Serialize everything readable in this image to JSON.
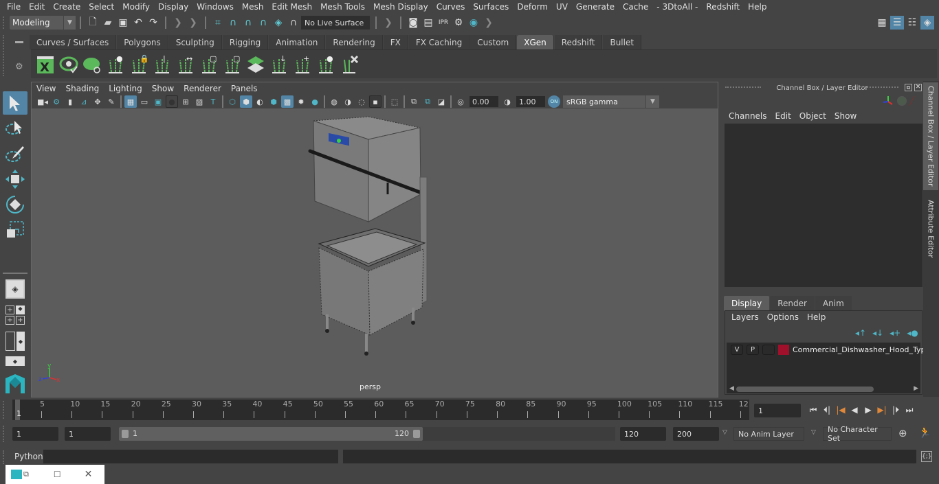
{
  "menubar": {
    "items": [
      "File",
      "Edit",
      "Create",
      "Select",
      "Modify",
      "Display",
      "Windows",
      "Mesh",
      "Edit Mesh",
      "Mesh Tools",
      "Mesh Display",
      "Curves",
      "Surfaces",
      "Deform",
      "UV",
      "Generate",
      "Cache",
      "- 3DtoAll -",
      "Redshift",
      "Help"
    ]
  },
  "statusline": {
    "mode": "Modeling",
    "live_surface": "No Live Surface"
  },
  "shelf": {
    "tabs": [
      "Curves / Surfaces",
      "Polygons",
      "Sculpting",
      "Rigging",
      "Animation",
      "Rendering",
      "FX",
      "FX Caching",
      "Custom",
      "XGen",
      "Redshift",
      "Bullet"
    ],
    "active_tab": "XGen",
    "icons": [
      "xgen-editor-icon",
      "preview-icon",
      "clear-preview-icon",
      "add-guides-icon",
      "place-guides-icon",
      "add-guide-icon",
      "show-guides-icon",
      "lock-guides-icon",
      "select-guides-icon",
      "sculpt-layer-icon",
      "flip-guides-icon",
      "select-region-icon",
      "bound-region-icon",
      "delete-guide-icon"
    ]
  },
  "viewport": {
    "menu": [
      "View",
      "Shading",
      "Lighting",
      "Show",
      "Renderer",
      "Panels"
    ],
    "exposure": "0.00",
    "gamma": "1.00",
    "color_space": "sRGB gamma",
    "color_mgmt": "ON",
    "camera_label": "persp",
    "axis": {
      "x": "x",
      "y": "y",
      "z": "z"
    }
  },
  "right_panel": {
    "title": "Channel Box / Layer Editor",
    "menu": [
      "Channels",
      "Edit",
      "Object",
      "Show"
    ],
    "side_tabs": [
      "Channel Box / Layer Editor",
      "Attribute Editor"
    ],
    "layer_tabs": [
      "Display",
      "Render",
      "Anim"
    ],
    "active_layer_tab": "Display",
    "layer_menu": [
      "Layers",
      "Options",
      "Help"
    ],
    "layers": [
      {
        "v": "V",
        "p": "P",
        "color": "#a0102a",
        "name": "Commercial_Dishwasher_Hood_Type_"
      }
    ]
  },
  "timeline": {
    "ticks": [
      "5",
      "10",
      "15",
      "20",
      "25",
      "30",
      "35",
      "40",
      "45",
      "50",
      "55",
      "60",
      "65",
      "70",
      "75",
      "80",
      "85",
      "90",
      "95",
      "100",
      "105",
      "110",
      "115",
      "12"
    ],
    "current_frame_marker": "1",
    "current_frame": "1"
  },
  "range": {
    "start": "1",
    "anim_start": "1",
    "range_start": "1",
    "range_end": "120",
    "end": "120",
    "anim_end": "200",
    "anim_layer": "No Anim Layer",
    "character_set": "No Character Set"
  },
  "command": {
    "language": "Python"
  }
}
